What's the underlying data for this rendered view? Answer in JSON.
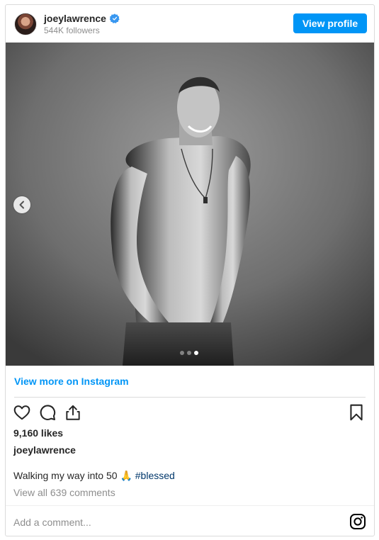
{
  "post": {
    "username": "joeylawrence",
    "followers": "544K followers",
    "view_profile": "View profile",
    "view_more": "View more on Instagram",
    "likes": "9,160 likes",
    "author": "joeylawrence",
    "caption_text": "Walking my way into 50 ",
    "caption_emoji": "🙏",
    "caption_hashtag": "#blessed",
    "comments_link": "View all 639 comments",
    "add_comment_placeholder": "Add a comment...",
    "carousel": {
      "total": 3,
      "active_index": 2
    }
  },
  "colors": {
    "accent": "#0095f6",
    "verified": "#3897f0",
    "hashtag": "#00376b",
    "muted": "#8e8e8e"
  },
  "icons": [
    "verified-icon",
    "chevron-left-icon",
    "heart-icon",
    "comment-icon",
    "share-icon",
    "bookmark-icon",
    "instagram-icon"
  ]
}
